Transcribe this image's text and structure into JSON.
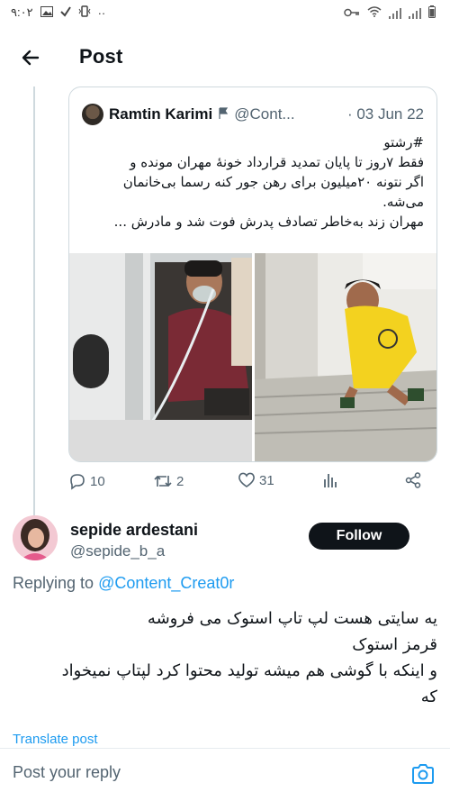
{
  "status_bar": {
    "time": "۹:۰۲",
    "dots": "··"
  },
  "header": {
    "title": "Post"
  },
  "quoted_post": {
    "author_name": "Ramtin Karimi",
    "author_handle": "@Cont...",
    "date": "· 03 Jun 22",
    "text_lines": [
      "#رشتو",
      "فقط ۷روز تا پایان تمدید قرارداد خونهٔ مهران مونده و",
      "اگر نتونه ۲۰میلیون برای رهن جور کنه رسما بی‌خانمان",
      "می‌شه.",
      "مهران زند به‌خاطر تصادف پدرش فوت شد و مادرش ..."
    ]
  },
  "actions": {
    "replies": "10",
    "reposts": "2",
    "likes": "31"
  },
  "reply": {
    "author_name": "sepide ardestani",
    "author_handle": "@sepide_b_a",
    "follow_label": "Follow",
    "replying_to_prefix": "Replying to",
    "replying_to_handle": "@Content_Creat0r",
    "text_lines": [
      "یه سایتی هست لپ تاپ استوک می فروشه",
      "قرمز استوک",
      "و اینکه با گوشی هم میشه تولید محتوا کرد لپتاپ نمیخواد",
      "که"
    ],
    "translate_label": "Translate post"
  },
  "composer": {
    "placeholder": "Post your reply"
  }
}
